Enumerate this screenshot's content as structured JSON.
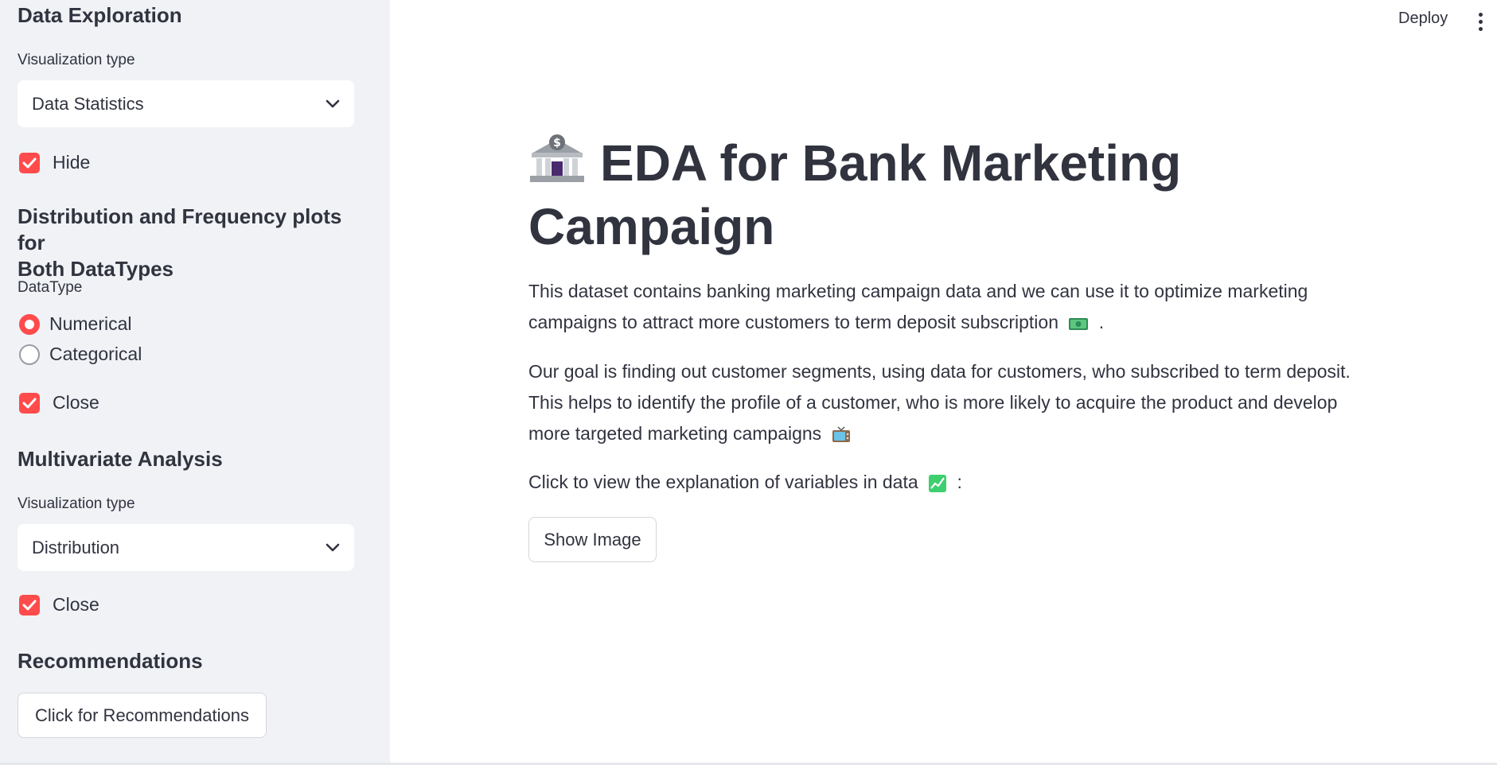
{
  "sidebar": {
    "section1_title": "Data Exploration",
    "viz_label": "Visualization type",
    "viz_select_value": "Data Statistics",
    "hide_checkbox_label": "Hide",
    "section2_title_line1": "Distribution and Frequency plots for",
    "section2_title_line2": "Both DataTypes",
    "datatype_label": "DataType",
    "radio_numerical": "Numerical",
    "radio_categorical": "Categorical",
    "close_checkbox_label_1": "Close",
    "section3_title": "Multivariate Analysis",
    "viz_label_2": "Visualization type",
    "viz_select_value_2": "Distribution",
    "close_checkbox_label_2": "Close",
    "section4_title": "Recommendations",
    "recommendations_button": "Click for Recommendations"
  },
  "header": {
    "deploy_label": "Deploy",
    "menu_icon": "kebab-menu-icon"
  },
  "main": {
    "title_line1": "EDA for Bank Marketing",
    "title_line2": "Campaign",
    "title_icon": "bank-icon",
    "para1_line1": "This dataset contains banking marketing campaign data and we can use it to optimize marketing",
    "para1_line2": "campaigns to attract more customers to term deposit subscription",
    "para1_icon": "money-icon",
    "para1_end": ".",
    "para2_line1": "Our goal is finding out customer segments, using data for customers, who subscribed to term deposit.",
    "para2_line2": "This helps to identify the profile of a customer, who is more likely to acquire the product and develop",
    "para2_line3": "more targeted marketing campaigns",
    "para2_icon": "television-icon",
    "para3_text": "Click to view the explanation of variables in data",
    "para3_icon": "chart-increasing-icon",
    "para3_end": ":",
    "show_image_button": "Show Image"
  },
  "colors": {
    "accent": "#ff4b4b",
    "sidebar_bg": "#f0f2f6",
    "text": "#31333f"
  }
}
